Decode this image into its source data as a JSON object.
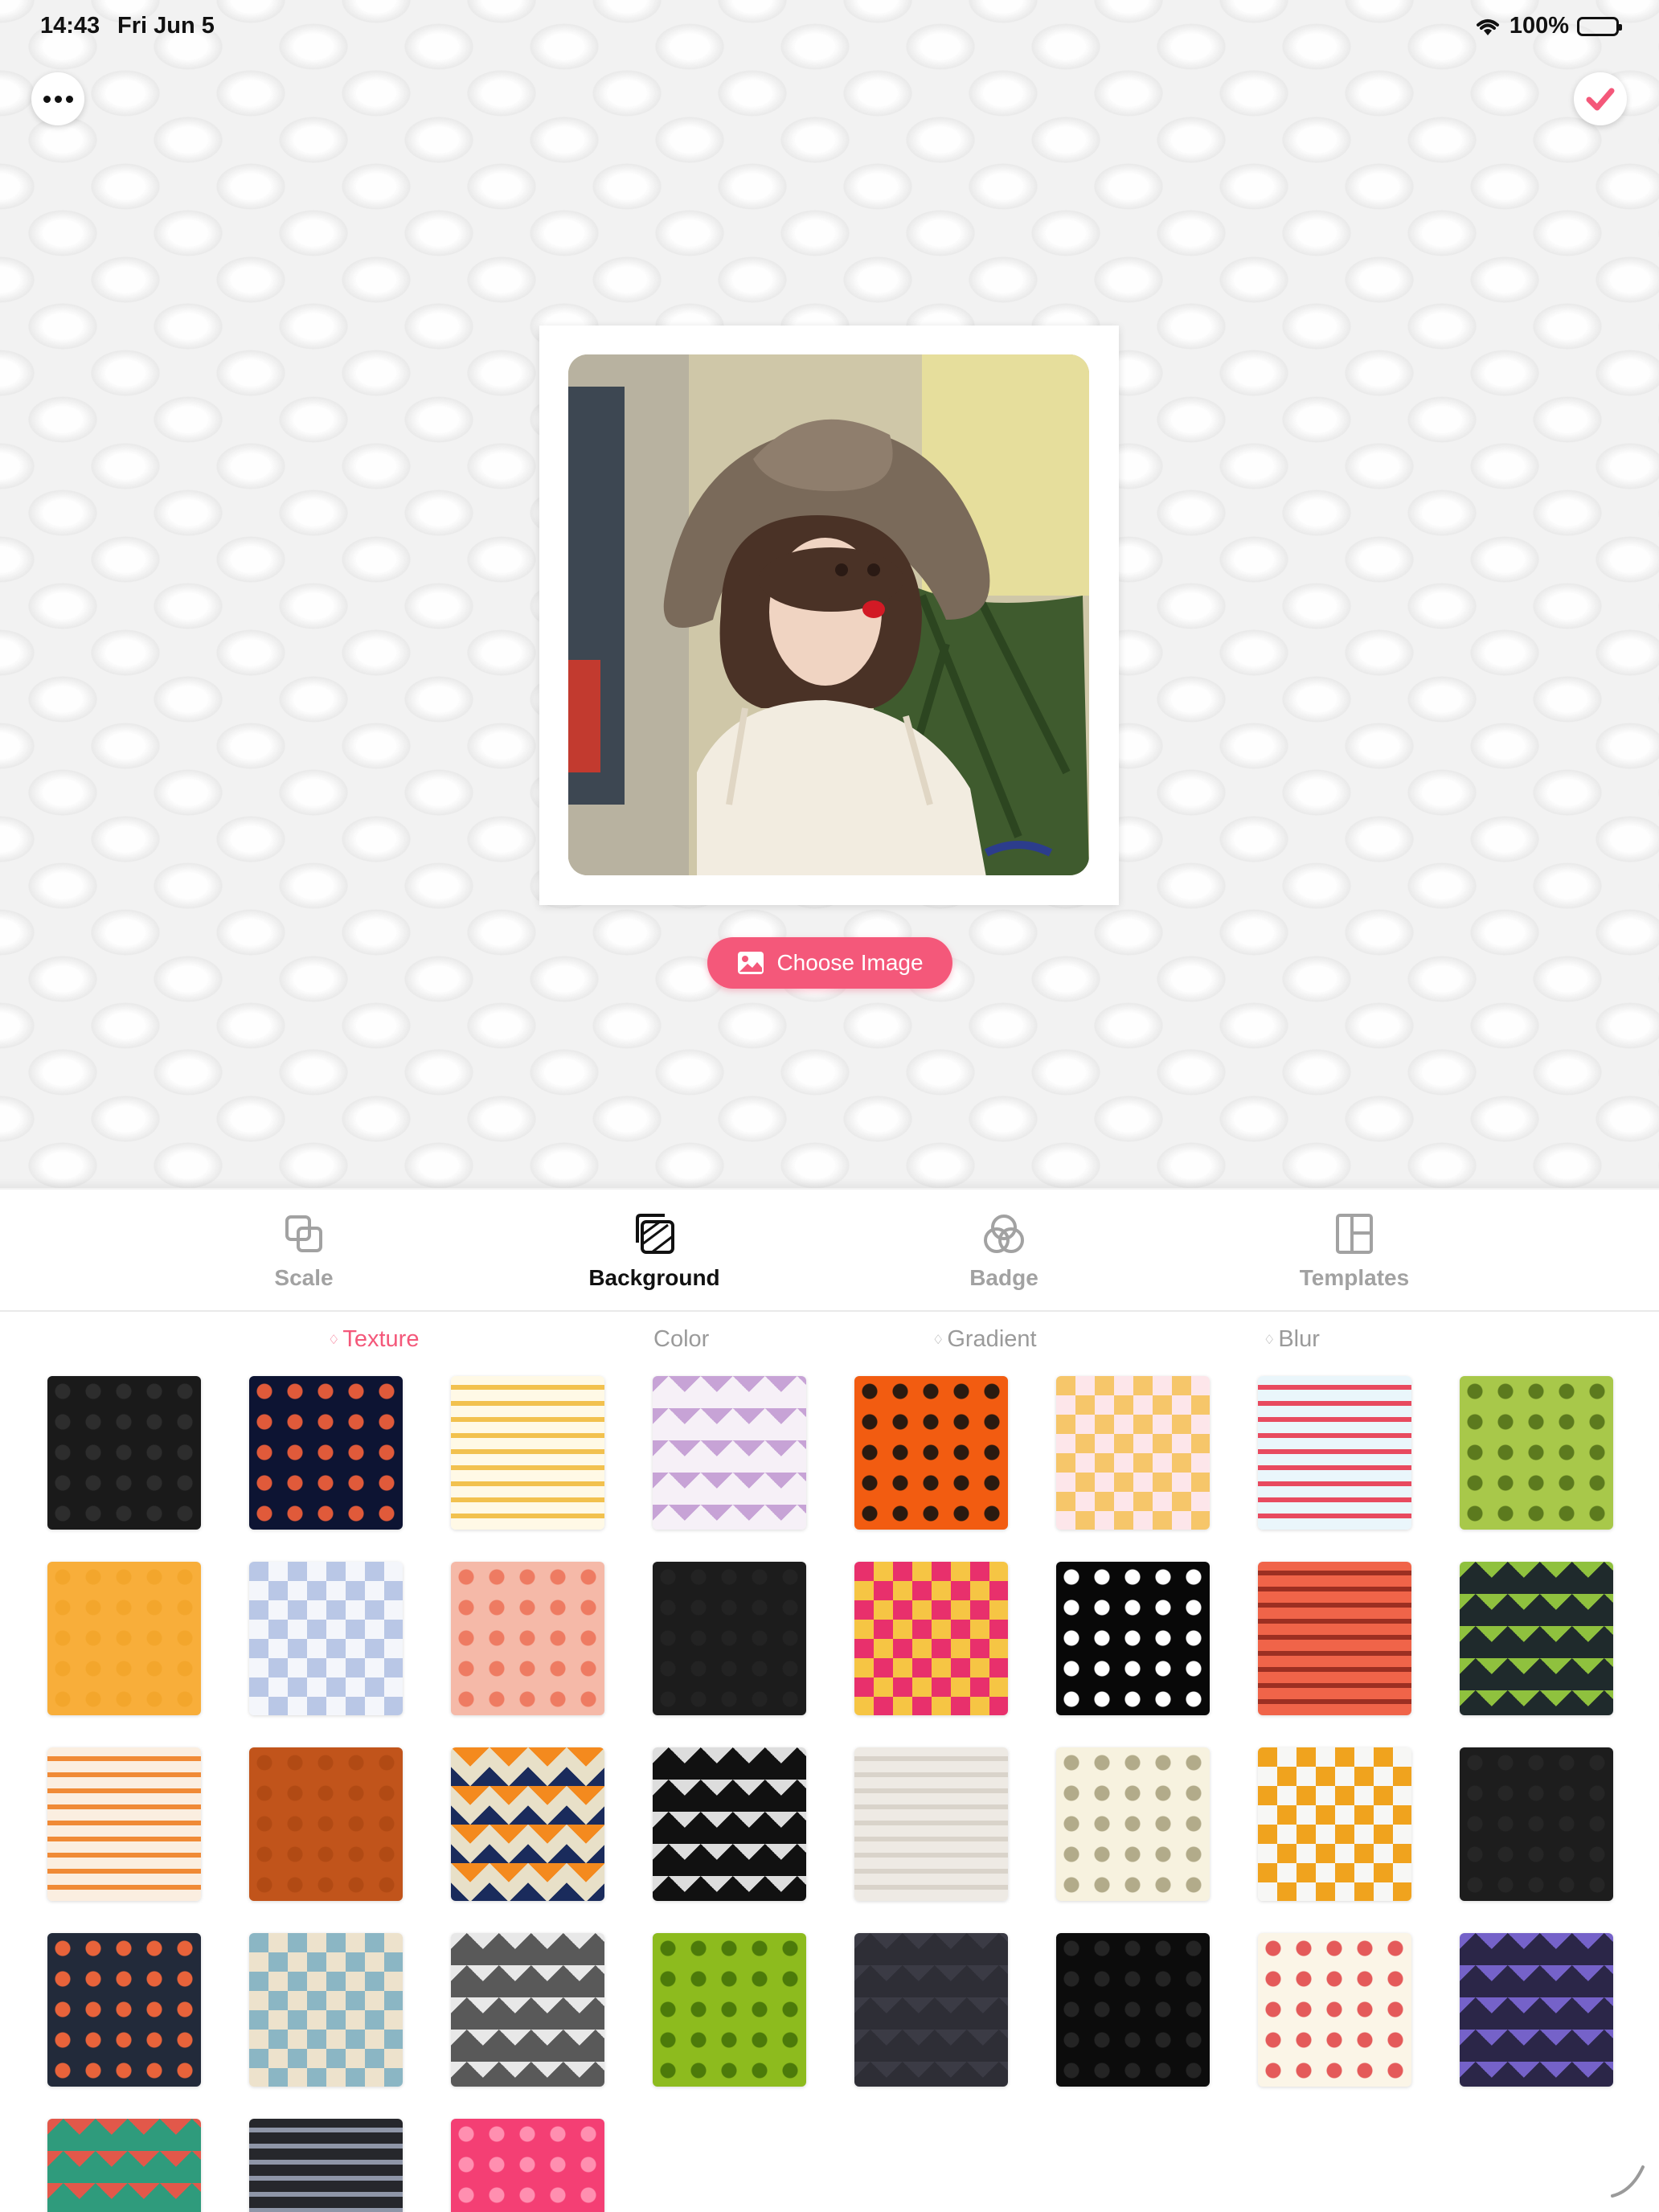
{
  "status_bar": {
    "time": "14:43",
    "date": "Fri Jun 5",
    "battery": "100%"
  },
  "canvas": {
    "choose_image_label": "Choose Image"
  },
  "toolbar": {
    "tabs": [
      {
        "label": "Scale",
        "icon": "scale-icon"
      },
      {
        "label": "Background",
        "icon": "background-icon",
        "active": true
      },
      {
        "label": "Badge",
        "icon": "badge-icon"
      },
      {
        "label": "Templates",
        "icon": "templates-icon"
      }
    ]
  },
  "subtabs": [
    {
      "label": "Texture",
      "premium": true,
      "active": true
    },
    {
      "label": "Color",
      "premium": false
    },
    {
      "label": "Gradient",
      "premium": true
    },
    {
      "label": "Blur",
      "premium": true
    }
  ],
  "colors": {
    "accent": "#f4587a",
    "active_text": "#111111",
    "inactive_text": "#a2a2a2"
  },
  "textures": [
    {
      "name": "black-dots",
      "a": "#1a1a1a",
      "b": "#2d2d2d",
      "style": "dots"
    },
    {
      "name": "space-planets",
      "a": "#0d1433",
      "b": "#e05a3a",
      "style": "dots"
    },
    {
      "name": "ginkgo-leaves",
      "a": "#fff9e6",
      "b": "#f2c14e",
      "style": "stripes"
    },
    {
      "name": "lavender-diamonds",
      "a": "#f6f0f7",
      "b": "#c7a3d6",
      "style": "diamond"
    },
    {
      "name": "orange-sunglasses",
      "a": "#f25c11",
      "b": "#2a1a10",
      "style": "dots"
    },
    {
      "name": "cat-checker",
      "a": "#fde6ea",
      "b": "#f6c66a",
      "style": "check"
    },
    {
      "name": "party-bunting",
      "a": "#eaf6fb",
      "b": "#e84a5f",
      "style": "stripes"
    },
    {
      "name": "kiwi-slices",
      "a": "#a8c84a",
      "b": "#5c7a1e",
      "style": "dots"
    },
    {
      "name": "orange-plain",
      "a": "#f8ae3a",
      "b": "#f3a62c",
      "style": "dots"
    },
    {
      "name": "blue-plaid",
      "a": "#f4f6fb",
      "b": "#b9c7e6",
      "style": "check"
    },
    {
      "name": "grapefruit-slices",
      "a": "#f5b9a8",
      "b": "#ee7b62",
      "style": "dots"
    },
    {
      "name": "black-plain",
      "a": "#1c1c1c",
      "b": "#232323",
      "style": "dots"
    },
    {
      "name": "pixel-squares",
      "a": "#f6c544",
      "b": "#e8306c",
      "style": "check"
    },
    {
      "name": "black-furniture",
      "a": "#080808",
      "b": "#ffffff",
      "style": "dots"
    },
    {
      "name": "red-doodle",
      "a": "#f06449",
      "b": "#9c2f22",
      "style": "stripes"
    },
    {
      "name": "triangle-mosaic",
      "a": "#1f2a2c",
      "b": "#8fc13e",
      "style": "diamond"
    },
    {
      "name": "kitchen-utensils",
      "a": "#fbeee0",
      "b": "#f08a36",
      "style": "stripes"
    },
    {
      "name": "burnt-orange",
      "a": "#c1541b",
      "b": "#b14a14",
      "style": "dots"
    },
    {
      "name": "zigzag-chevron",
      "a": "#1a2b5c",
      "b": "#f48a1e",
      "style": "zigzag"
    },
    {
      "name": "black-white-cubes",
      "a": "#111111",
      "b": "#dddddd",
      "style": "diamond"
    },
    {
      "name": "white-wood",
      "a": "#eeeae4",
      "b": "#d9d3ca",
      "style": "stripes"
    },
    {
      "name": "cream-circles",
      "a": "#f7f2df",
      "b": "#b2ab8a",
      "style": "dots"
    },
    {
      "name": "metro-map",
      "a": "#f7f7f5",
      "b": "#f0a31e",
      "style": "check"
    },
    {
      "name": "dark-slate",
      "a": "#1d1d1d",
      "b": "#262626",
      "style": "dots"
    },
    {
      "name": "sushi-rolls",
      "a": "#222a3a",
      "b": "#e8633a",
      "style": "dots"
    },
    {
      "name": "postage-stamps",
      "a": "#ede2cc",
      "b": "#8bb6c4",
      "style": "check"
    },
    {
      "name": "grey-isometric",
      "a": "#595959",
      "b": "#e8e8e8",
      "style": "diamond"
    },
    {
      "name": "green-swirls",
      "a": "#8dbb1e",
      "b": "#4c7a0a",
      "style": "dots"
    },
    {
      "name": "charcoal-geometric",
      "a": "#2e2e36",
      "b": "#3b3b45",
      "style": "diamond"
    },
    {
      "name": "black-sunburst",
      "a": "#0c0c0c",
      "b": "#242424",
      "style": "dots"
    },
    {
      "name": "music-doodle",
      "a": "#fbf5e7",
      "b": "#e45a5a",
      "style": "dots"
    },
    {
      "name": "purple-isometric",
      "a": "#2b2648",
      "b": "#7562c9",
      "style": "diamond"
    },
    {
      "name": "rainbow-triangles",
      "a": "#2f9b7c",
      "b": "#e2584a",
      "style": "diamond"
    },
    {
      "name": "city-names",
      "a": "#26272c",
      "b": "#8f96a8",
      "style": "stripes"
    },
    {
      "name": "pink-lace",
      "a": "#f43f74",
      "b": "#ff8fb0",
      "style": "dots"
    }
  ]
}
